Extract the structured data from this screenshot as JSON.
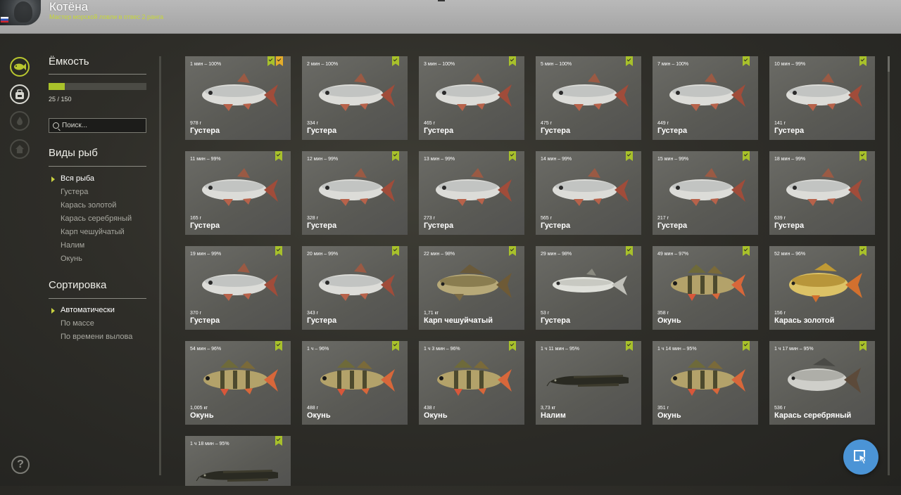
{
  "header": {
    "username": "Котёна",
    "title": "Мастер морской ловли в отвес 2 ранга"
  },
  "sidebar_icons": [
    "fish-icon",
    "backpack-icon",
    "campfire-icon",
    "home-icon",
    "help-icon"
  ],
  "help_label": "?",
  "capacity": {
    "heading": "Ёмкость",
    "text": "25 / 150",
    "fraction": 0.1667
  },
  "search": {
    "placeholder": "Поиск..."
  },
  "species": {
    "heading": "Виды рыб",
    "items": [
      "Вся рыба",
      "Густера",
      "Карась золотой",
      "Карась серебряный",
      "Карп чешуйчатый",
      "Налим",
      "Окунь"
    ],
    "selected": 0
  },
  "sort": {
    "heading": "Сортировка",
    "items": [
      "Автоматически",
      "По массе",
      "По времени вылова"
    ],
    "selected": 0
  },
  "colors": {
    "accent": "#a8c12b",
    "gold_badge": "#e4ad2a",
    "fab": "#4b94d6"
  },
  "fish": [
    {
      "time": "1 мин – 100%",
      "weight": "978 г",
      "name": "Густера",
      "kind": "bream",
      "gold": true
    },
    {
      "time": "2 мин – 100%",
      "weight": "334 г",
      "name": "Густера",
      "kind": "bream"
    },
    {
      "time": "3 мин – 100%",
      "weight": "465 г",
      "name": "Густера",
      "kind": "bream"
    },
    {
      "time": "5 мин – 100%",
      "weight": "475 г",
      "name": "Густера",
      "kind": "bream"
    },
    {
      "time": "7 мин – 100%",
      "weight": "449 г",
      "name": "Густера",
      "kind": "bream"
    },
    {
      "time": "10 мин – 99%",
      "weight": "141 г",
      "name": "Густера",
      "kind": "bream"
    },
    {
      "time": "11 мин – 99%",
      "weight": "165 г",
      "name": "Густера",
      "kind": "bream"
    },
    {
      "time": "12 мин – 99%",
      "weight": "328 г",
      "name": "Густера",
      "kind": "bream"
    },
    {
      "time": "13 мин – 99%",
      "weight": "273 г",
      "name": "Густера",
      "kind": "bream"
    },
    {
      "time": "14 мин – 99%",
      "weight": "565 г",
      "name": "Густера",
      "kind": "bream"
    },
    {
      "time": "15 мин – 99%",
      "weight": "217 г",
      "name": "Густера",
      "kind": "bream"
    },
    {
      "time": "18 мин – 99%",
      "weight": "639 г",
      "name": "Густера",
      "kind": "bream"
    },
    {
      "time": "19 мин – 99%",
      "weight": "370 г",
      "name": "Густера",
      "kind": "bream"
    },
    {
      "time": "20 мин – 99%",
      "weight": "343 г",
      "name": "Густера",
      "kind": "bream"
    },
    {
      "time": "22 мин – 98%",
      "weight": "1,71 кг",
      "name": "Карп чешуйчатый",
      "kind": "carp"
    },
    {
      "time": "29 мин – 98%",
      "weight": "53 г",
      "name": "Густера",
      "kind": "bream_small"
    },
    {
      "time": "49 мин – 97%",
      "weight": "358 г",
      "name": "Окунь",
      "kind": "perch"
    },
    {
      "time": "52 мин – 96%",
      "weight": "156 г",
      "name": "Карась золотой",
      "kind": "golden"
    },
    {
      "time": "54 мин – 96%",
      "weight": "1,005 кг",
      "name": "Окунь",
      "kind": "perch"
    },
    {
      "time": "1 ч – 96%",
      "weight": "488 г",
      "name": "Окунь",
      "kind": "perch"
    },
    {
      "time": "1 ч 3 мин – 96%",
      "weight": "438 г",
      "name": "Окунь",
      "kind": "perch"
    },
    {
      "time": "1 ч 11 мин – 95%",
      "weight": "3,73 кг",
      "name": "Налим",
      "kind": "burbot"
    },
    {
      "time": "1 ч 14 мин – 95%",
      "weight": "351 г",
      "name": "Окунь",
      "kind": "perch"
    },
    {
      "time": "1 ч 17 мин – 95%",
      "weight": "536 г",
      "name": "Карась серебряный",
      "kind": "silver"
    },
    {
      "time": "1 ч 18 мин – 95%",
      "weight": "",
      "name": "",
      "kind": "burbot"
    }
  ]
}
